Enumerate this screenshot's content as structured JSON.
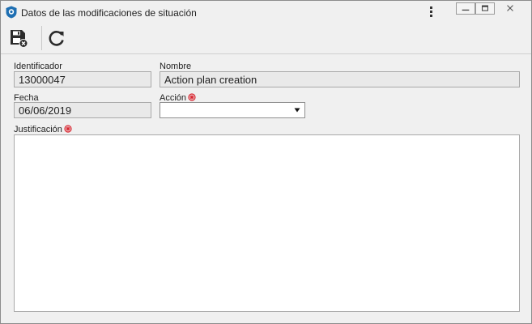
{
  "window": {
    "title": "Datos de las modificaciones de situación",
    "app_icon": "app-shield-icon",
    "menu_icon": "kebab-menu-icon",
    "controls": [
      "minimize-icon",
      "maximize-icon",
      "close-icon"
    ]
  },
  "toolbar": {
    "save_icon": "save-and-close-icon",
    "refresh_icon": "refresh-icon"
  },
  "form": {
    "identificador": {
      "label": "Identificador",
      "value": "13000047"
    },
    "nombre": {
      "label": "Nombre",
      "value": "Action plan creation"
    },
    "fecha": {
      "label": "Fecha",
      "value": "06/06/2019"
    },
    "accion": {
      "label": "Acción",
      "value": "",
      "required": true
    },
    "justificacion": {
      "label": "Justificación",
      "value": "",
      "required": true
    }
  },
  "colors": {
    "background": "#f0f0f0",
    "readonly_field": "#e9e9e9",
    "required_marker": "#d9232d",
    "app_icon": "#1f6fb2"
  }
}
